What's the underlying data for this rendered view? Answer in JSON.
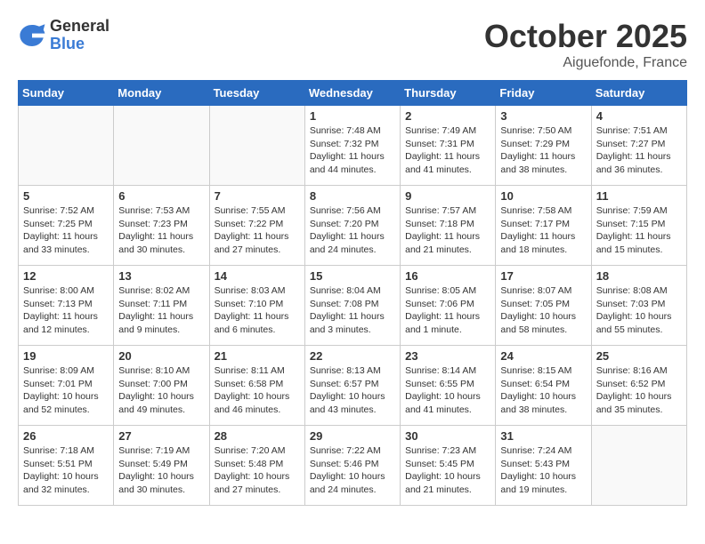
{
  "logo": {
    "general": "General",
    "blue": "Blue"
  },
  "title": "October 2025",
  "location": "Aiguefonde, France",
  "days_of_week": [
    "Sunday",
    "Monday",
    "Tuesday",
    "Wednesday",
    "Thursday",
    "Friday",
    "Saturday"
  ],
  "weeks": [
    [
      {
        "day": "",
        "info": ""
      },
      {
        "day": "",
        "info": ""
      },
      {
        "day": "",
        "info": ""
      },
      {
        "day": "1",
        "info": "Sunrise: 7:48 AM\nSunset: 7:32 PM\nDaylight: 11 hours and 44 minutes."
      },
      {
        "day": "2",
        "info": "Sunrise: 7:49 AM\nSunset: 7:31 PM\nDaylight: 11 hours and 41 minutes."
      },
      {
        "day": "3",
        "info": "Sunrise: 7:50 AM\nSunset: 7:29 PM\nDaylight: 11 hours and 38 minutes."
      },
      {
        "day": "4",
        "info": "Sunrise: 7:51 AM\nSunset: 7:27 PM\nDaylight: 11 hours and 36 minutes."
      }
    ],
    [
      {
        "day": "5",
        "info": "Sunrise: 7:52 AM\nSunset: 7:25 PM\nDaylight: 11 hours and 33 minutes."
      },
      {
        "day": "6",
        "info": "Sunrise: 7:53 AM\nSunset: 7:23 PM\nDaylight: 11 hours and 30 minutes."
      },
      {
        "day": "7",
        "info": "Sunrise: 7:55 AM\nSunset: 7:22 PM\nDaylight: 11 hours and 27 minutes."
      },
      {
        "day": "8",
        "info": "Sunrise: 7:56 AM\nSunset: 7:20 PM\nDaylight: 11 hours and 24 minutes."
      },
      {
        "day": "9",
        "info": "Sunrise: 7:57 AM\nSunset: 7:18 PM\nDaylight: 11 hours and 21 minutes."
      },
      {
        "day": "10",
        "info": "Sunrise: 7:58 AM\nSunset: 7:17 PM\nDaylight: 11 hours and 18 minutes."
      },
      {
        "day": "11",
        "info": "Sunrise: 7:59 AM\nSunset: 7:15 PM\nDaylight: 11 hours and 15 minutes."
      }
    ],
    [
      {
        "day": "12",
        "info": "Sunrise: 8:00 AM\nSunset: 7:13 PM\nDaylight: 11 hours and 12 minutes."
      },
      {
        "day": "13",
        "info": "Sunrise: 8:02 AM\nSunset: 7:11 PM\nDaylight: 11 hours and 9 minutes."
      },
      {
        "day": "14",
        "info": "Sunrise: 8:03 AM\nSunset: 7:10 PM\nDaylight: 11 hours and 6 minutes."
      },
      {
        "day": "15",
        "info": "Sunrise: 8:04 AM\nSunset: 7:08 PM\nDaylight: 11 hours and 3 minutes."
      },
      {
        "day": "16",
        "info": "Sunrise: 8:05 AM\nSunset: 7:06 PM\nDaylight: 11 hours and 1 minute."
      },
      {
        "day": "17",
        "info": "Sunrise: 8:07 AM\nSunset: 7:05 PM\nDaylight: 10 hours and 58 minutes."
      },
      {
        "day": "18",
        "info": "Sunrise: 8:08 AM\nSunset: 7:03 PM\nDaylight: 10 hours and 55 minutes."
      }
    ],
    [
      {
        "day": "19",
        "info": "Sunrise: 8:09 AM\nSunset: 7:01 PM\nDaylight: 10 hours and 52 minutes."
      },
      {
        "day": "20",
        "info": "Sunrise: 8:10 AM\nSunset: 7:00 PM\nDaylight: 10 hours and 49 minutes."
      },
      {
        "day": "21",
        "info": "Sunrise: 8:11 AM\nSunset: 6:58 PM\nDaylight: 10 hours and 46 minutes."
      },
      {
        "day": "22",
        "info": "Sunrise: 8:13 AM\nSunset: 6:57 PM\nDaylight: 10 hours and 43 minutes."
      },
      {
        "day": "23",
        "info": "Sunrise: 8:14 AM\nSunset: 6:55 PM\nDaylight: 10 hours and 41 minutes."
      },
      {
        "day": "24",
        "info": "Sunrise: 8:15 AM\nSunset: 6:54 PM\nDaylight: 10 hours and 38 minutes."
      },
      {
        "day": "25",
        "info": "Sunrise: 8:16 AM\nSunset: 6:52 PM\nDaylight: 10 hours and 35 minutes."
      }
    ],
    [
      {
        "day": "26",
        "info": "Sunrise: 7:18 AM\nSunset: 5:51 PM\nDaylight: 10 hours and 32 minutes."
      },
      {
        "day": "27",
        "info": "Sunrise: 7:19 AM\nSunset: 5:49 PM\nDaylight: 10 hours and 30 minutes."
      },
      {
        "day": "28",
        "info": "Sunrise: 7:20 AM\nSunset: 5:48 PM\nDaylight: 10 hours and 27 minutes."
      },
      {
        "day": "29",
        "info": "Sunrise: 7:22 AM\nSunset: 5:46 PM\nDaylight: 10 hours and 24 minutes."
      },
      {
        "day": "30",
        "info": "Sunrise: 7:23 AM\nSunset: 5:45 PM\nDaylight: 10 hours and 21 minutes."
      },
      {
        "day": "31",
        "info": "Sunrise: 7:24 AM\nSunset: 5:43 PM\nDaylight: 10 hours and 19 minutes."
      },
      {
        "day": "",
        "info": ""
      }
    ]
  ]
}
